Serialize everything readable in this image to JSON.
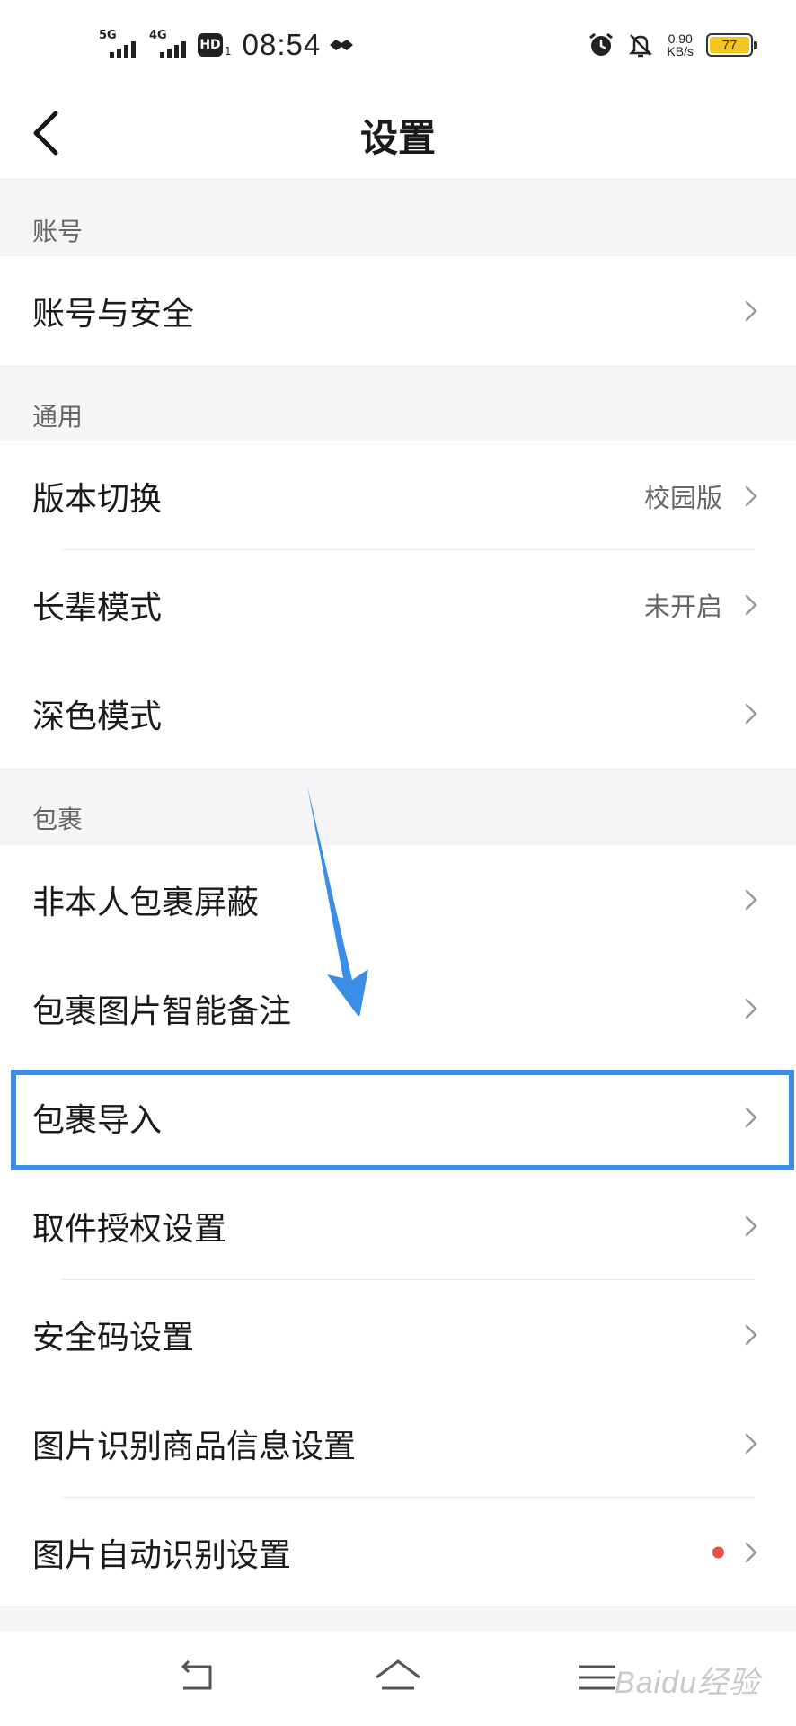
{
  "status_bar": {
    "net1_label": "5G",
    "net2_label": "4G",
    "hd_label": "HD",
    "hd_sub": "1",
    "time": "08:54",
    "speed_value": "0.90",
    "speed_unit": "KB/s",
    "battery": "77",
    "battery_color": "#f3c623",
    "icons": [
      "signal-icon",
      "hd-icon",
      "handshake-icon",
      "alarm-icon",
      "mute-icon",
      "battery-icon"
    ]
  },
  "header": {
    "title": "设置",
    "back_icon": "chevron-left-icon"
  },
  "sections": [
    {
      "title": "账号",
      "items": [
        {
          "label": "账号与安全",
          "value": ""
        }
      ]
    },
    {
      "title": "通用",
      "items": [
        {
          "label": "版本切换",
          "value": "校园版"
        },
        {
          "label": "长辈模式",
          "value": "未开启"
        },
        {
          "label": "深色模式",
          "value": ""
        }
      ]
    },
    {
      "title": "包裹",
      "items": [
        {
          "label": "非本人包裹屏蔽",
          "value": ""
        },
        {
          "label": "包裹图片智能备注",
          "value": ""
        },
        {
          "label": "包裹导入",
          "value": "",
          "highlighted": true
        },
        {
          "label": "取件授权设置",
          "value": ""
        },
        {
          "label": "安全码设置",
          "value": ""
        },
        {
          "label": "图片识别商品信息设置",
          "value": ""
        },
        {
          "label": "图片自动识别设置",
          "value": "",
          "badge": "red-dot"
        }
      ]
    }
  ],
  "annotation": {
    "highlight_color": "#3a8ee6",
    "arrow_color": "#3a8ee6"
  },
  "nav_bar": {
    "buttons": [
      "back-nav-icon",
      "home-nav-icon",
      "menu-nav-icon"
    ],
    "watermark": "Baidu经验"
  }
}
